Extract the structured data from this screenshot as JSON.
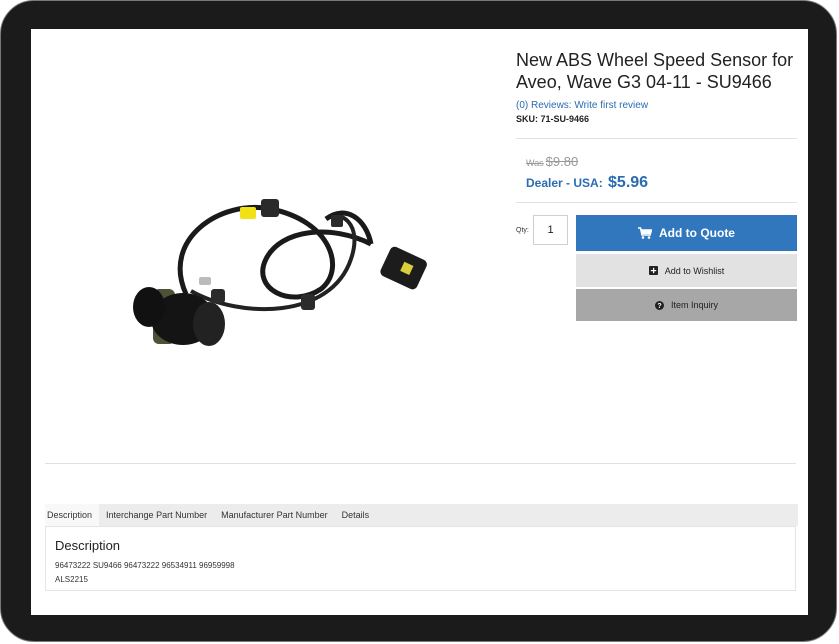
{
  "product": {
    "title": "New ABS Wheel Speed Sensor for Aveo, Wave G3 04-11 - SU9466",
    "reviews_link": "(0) Reviews: Write first review",
    "sku": "SKU: 71-SU-9466",
    "was_label": "Was",
    "was_value": "$9.80",
    "dealer_label": "Dealer - USA:",
    "dealer_price": "$5.96",
    "qty_label": "Qty:",
    "qty_value": "1"
  },
  "actions": {
    "add_to_quote": "Add to Quote",
    "add_to_wishlist": "Add to Wishlist",
    "item_inquiry": "Item Inquiry"
  },
  "tabs": [
    "Description",
    "Interchange Part Number",
    "Manufacturer Part Number",
    "Details"
  ],
  "description": {
    "heading": "Description",
    "line1": "96473222 SU9466 96473222 96534911 96959998",
    "line2": "ALS2215"
  },
  "colors": {
    "accent": "#3177be",
    "link": "#2a6cb0",
    "wishlist_bg": "#e2e2e2",
    "inquiry_bg": "#a7a7a7",
    "bezel": "#1b1b1b"
  },
  "icons": {
    "quote": "cart-icon",
    "wishlist": "plus-square-icon",
    "inquiry": "question-circle-icon"
  }
}
